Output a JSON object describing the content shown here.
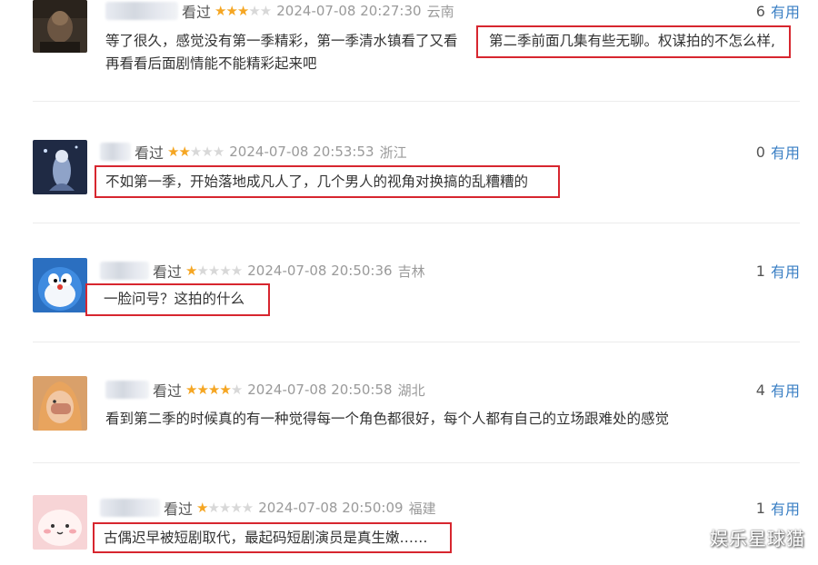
{
  "reviews": [
    {
      "watched": "看过",
      "rating": 3,
      "time": "2024-07-08 20:27:30",
      "location": "云南",
      "useful_count": "6",
      "useful_label": "有用",
      "text_lines": [
        "等了很久，感觉没有第一季精彩，第一季清水镇看了又看",
        "再看看后面剧情能不能精彩起来吧"
      ],
      "highlight": "第二季前面几集有些无聊。权谋拍的不怎么样,"
    },
    {
      "watched": "看过",
      "rating": 2,
      "time": "2024-07-08 20:53:53",
      "location": "浙江",
      "useful_count": "0",
      "useful_label": "有用",
      "text": "不如第一季，开始落地成凡人了，几个男人的视角对换搞的乱糟糟的"
    },
    {
      "watched": "看过",
      "rating": 1,
      "time": "2024-07-08 20:50:36",
      "location": "吉林",
      "useful_count": "1",
      "useful_label": "有用",
      "text": "一脸问号？这拍的什么"
    },
    {
      "watched": "看过",
      "rating": 4,
      "time": "2024-07-08 20:50:58",
      "location": "湖北",
      "useful_count": "4",
      "useful_label": "有用",
      "text": "看到第二季的时候真的有一种觉得每一个角色都很好，每个人都有自己的立场跟难处的感觉"
    },
    {
      "watched": "看过",
      "rating": 1,
      "time": "2024-07-08 20:50:09",
      "location": "福建",
      "useful_count": "1",
      "useful_label": "有用",
      "text": "古偶迟早被短剧取代，最起码短剧演员是真生嫩……"
    }
  ],
  "watermark": "娱乐星球猫",
  "colors": {
    "star": "#f5a623",
    "star_empty": "#d8d8d8",
    "link": "#3a7fc4",
    "highlight_box": "#d7262f"
  }
}
